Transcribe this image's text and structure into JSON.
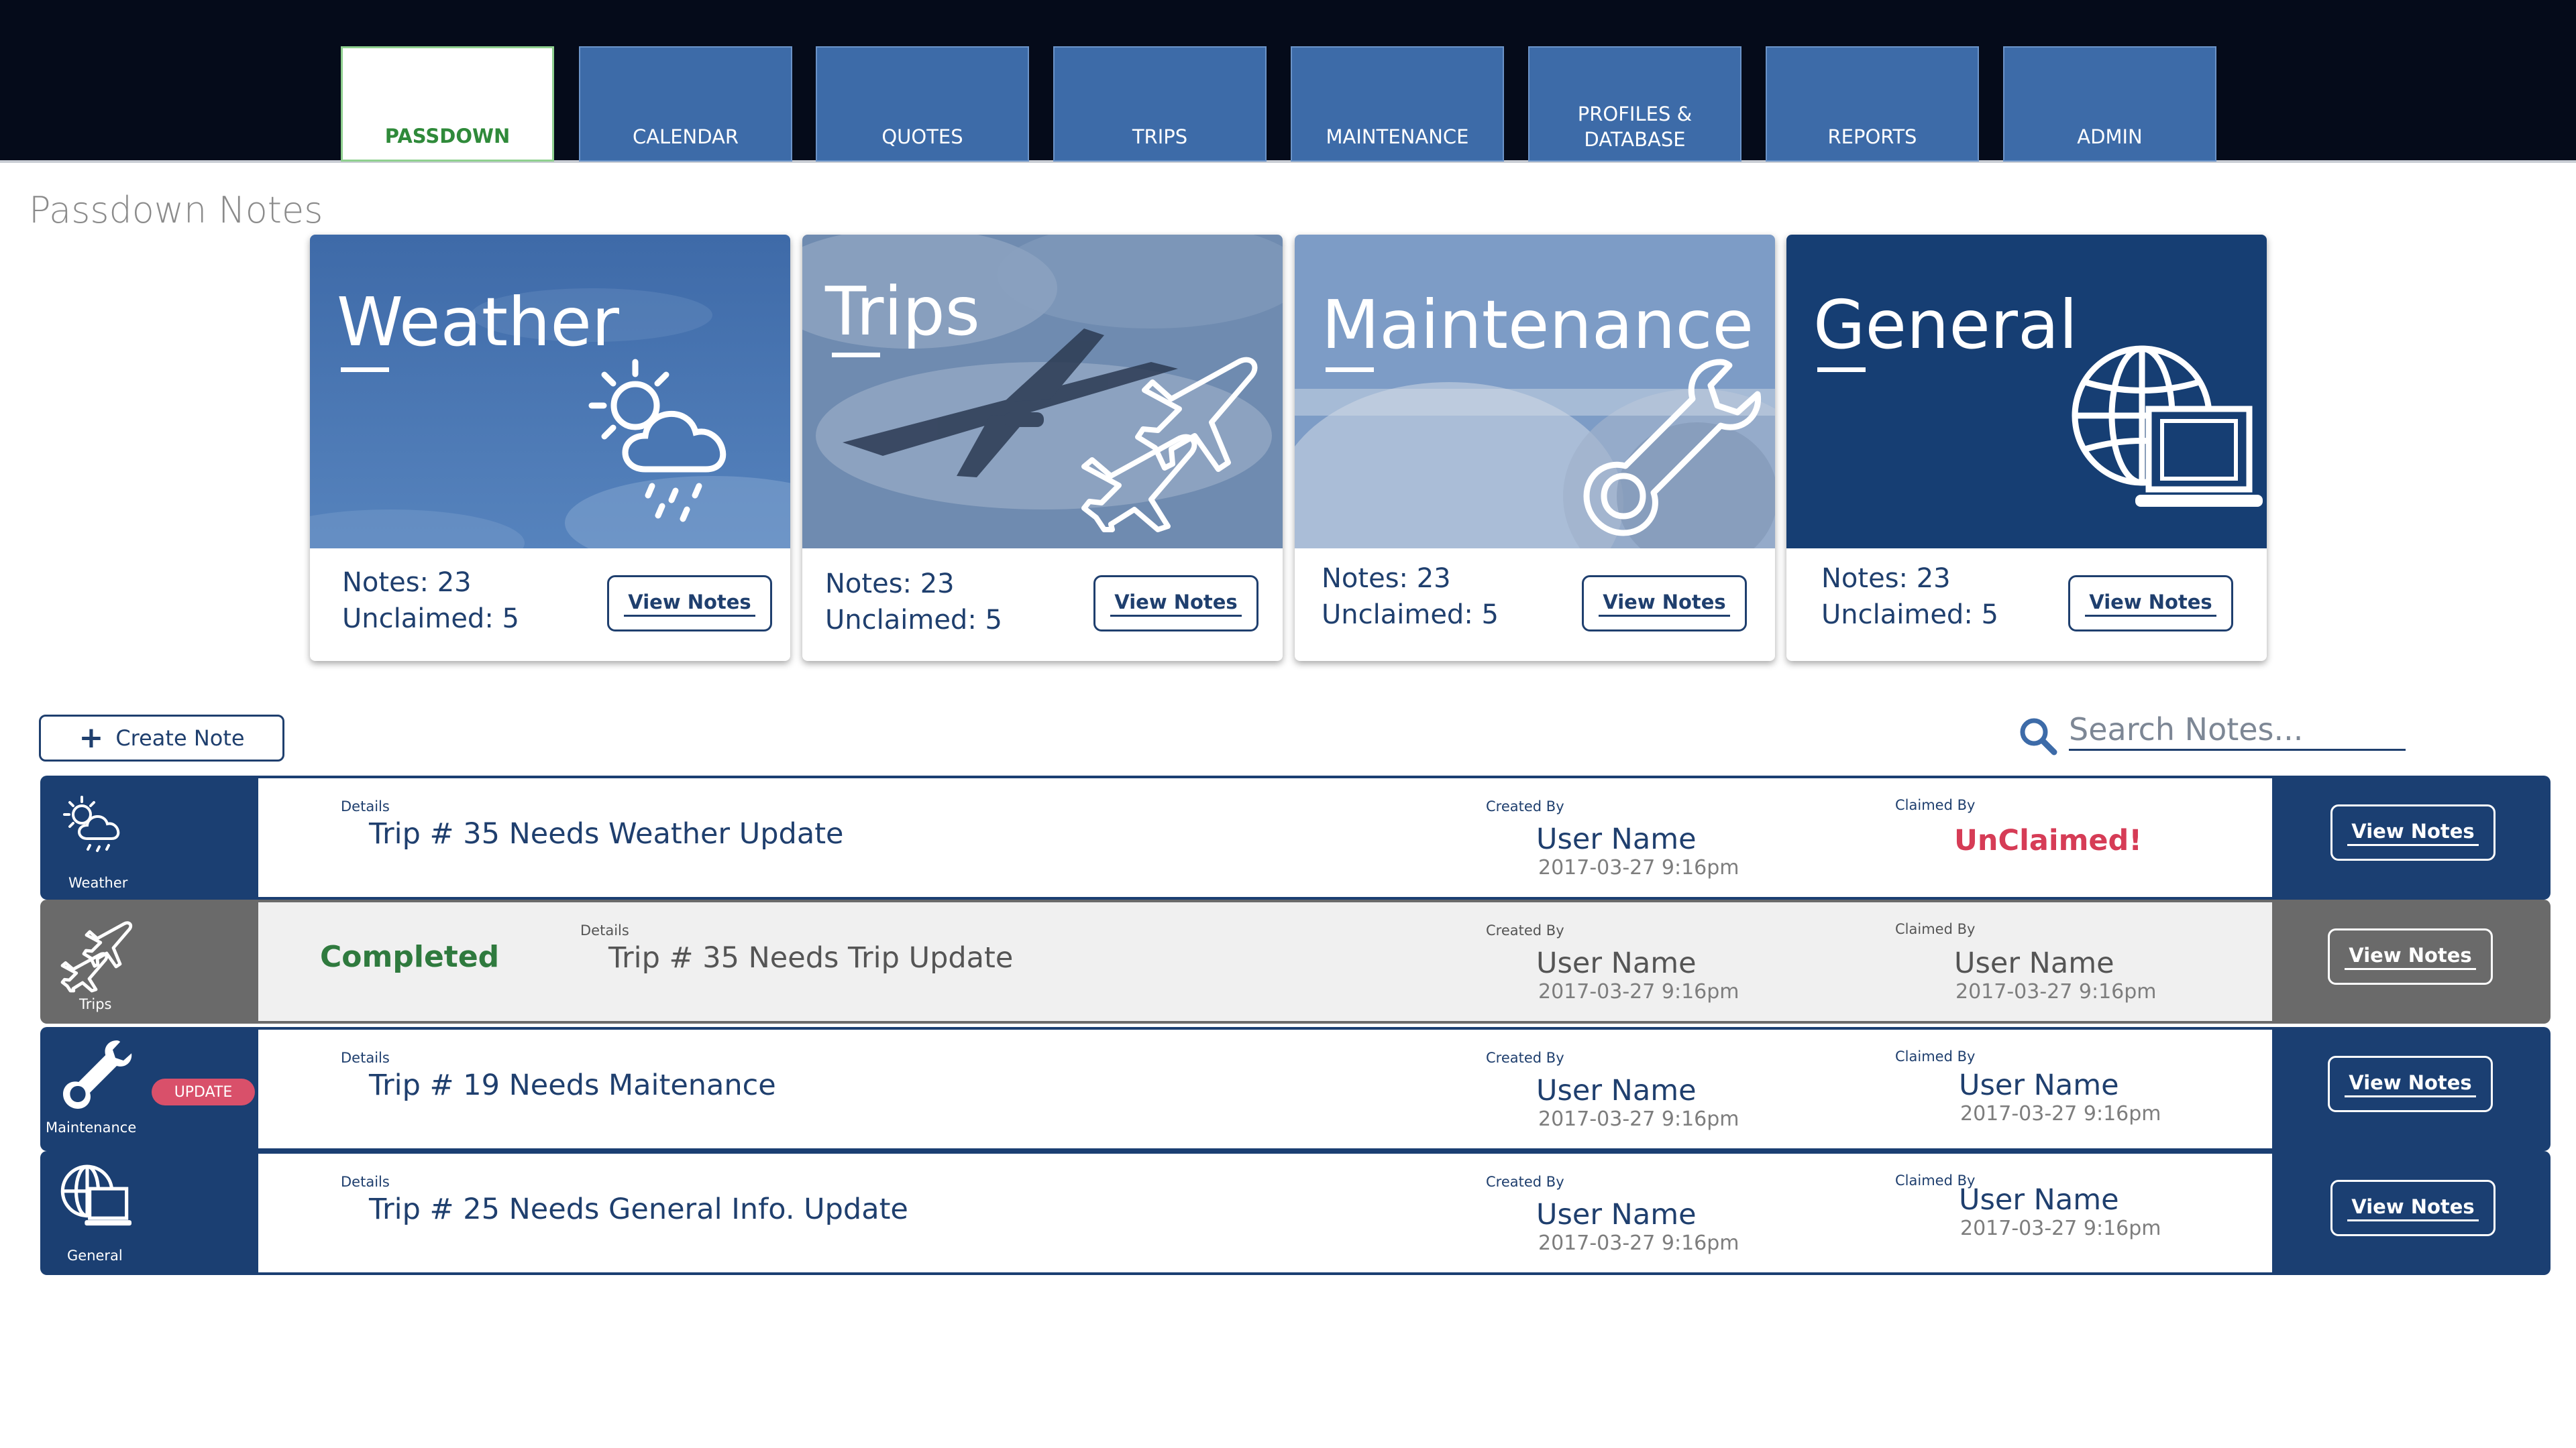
{
  "nav": {
    "tabs": [
      {
        "label": "PASSDOWN",
        "active": true
      },
      {
        "label": "CALENDAR",
        "active": false
      },
      {
        "label": "QUOTES",
        "active": false
      },
      {
        "label": "TRIPS",
        "active": false
      },
      {
        "label": "MAINTENANCE",
        "active": false
      },
      {
        "label": "PROFILES & DATABASE",
        "active": false
      },
      {
        "label": "REPORTS",
        "active": false
      },
      {
        "label": "ADMIN",
        "active": false
      }
    ]
  },
  "page": {
    "title": "Passdown Notes"
  },
  "cards": [
    {
      "title": "Weather",
      "notes": "Notes:  23",
      "unclaimed": "Unclaimed: 5",
      "button": "View Notes",
      "icon": "weather-icon"
    },
    {
      "title": "Trips",
      "notes": "Notes:  23",
      "unclaimed": "Unclaimed: 5",
      "button": "View Notes",
      "icon": "airplanes-icon"
    },
    {
      "title": "Maintenance",
      "notes": "Notes:  23",
      "unclaimed": "Unclaimed: 5",
      "button": "View Notes",
      "icon": "wrench-icon"
    },
    {
      "title": "General",
      "notes": "Notes:  23",
      "unclaimed": "Unclaimed: 5",
      "button": "View Notes",
      "icon": "globe-laptop-icon"
    }
  ],
  "toolbar": {
    "create_label": "Create Note",
    "create_icon": "plus-icon",
    "search_placeholder": "Search Notes...",
    "search_icon": "search-icon"
  },
  "rows": [
    {
      "category": "Weather",
      "details_label": "Details",
      "details": "Trip # 35 Needs Weather Update",
      "created_label": "Created By",
      "created_by": "User Name",
      "created_at": "2017-03-27 9:16pm",
      "claimed_label": "Claimed By",
      "claimed_status": "UnClaimed!",
      "button": "View Notes"
    },
    {
      "category": "Trips",
      "status": "Completed",
      "details_label": "Details",
      "details": "Trip # 35 Needs Trip Update",
      "created_label": "Created By",
      "created_by": "User Name",
      "created_at": "2017-03-27 9:16pm",
      "claimed_label": "Claimed By",
      "claimed_by": "User Name",
      "claimed_at": "2017-03-27 9:16pm",
      "button": "View Notes"
    },
    {
      "category": "Maintenance",
      "badge": "UPDATE",
      "details_label": "Details",
      "details": "Trip # 19 Needs Maitenance",
      "created_label": "Created By",
      "created_by": "User Name",
      "created_at": "2017-03-27 9:16pm",
      "claimed_label": "Claimed By",
      "claimed_by": "User Name",
      "claimed_at": "2017-03-27 9:16pm",
      "button": "View Notes"
    },
    {
      "category": "General",
      "details_label": "Details",
      "details": "Trip # 25 Needs General Info. Update",
      "created_label": "Created By",
      "created_by": "User Name",
      "created_at": "2017-03-27 9:16pm",
      "claimed_label": "Claimed By",
      "claimed_by": "User Name",
      "claimed_at": "2017-03-27 9:16pm",
      "button": "View Notes"
    }
  ],
  "colors": {
    "navy": "#1b3f72",
    "nav_tab": "#3d6ba8",
    "active_green": "#2f8a3a",
    "unclaimed_red": "#d63c56",
    "completed_green": "#2f7a3e",
    "badge_pink": "#d9506a"
  }
}
